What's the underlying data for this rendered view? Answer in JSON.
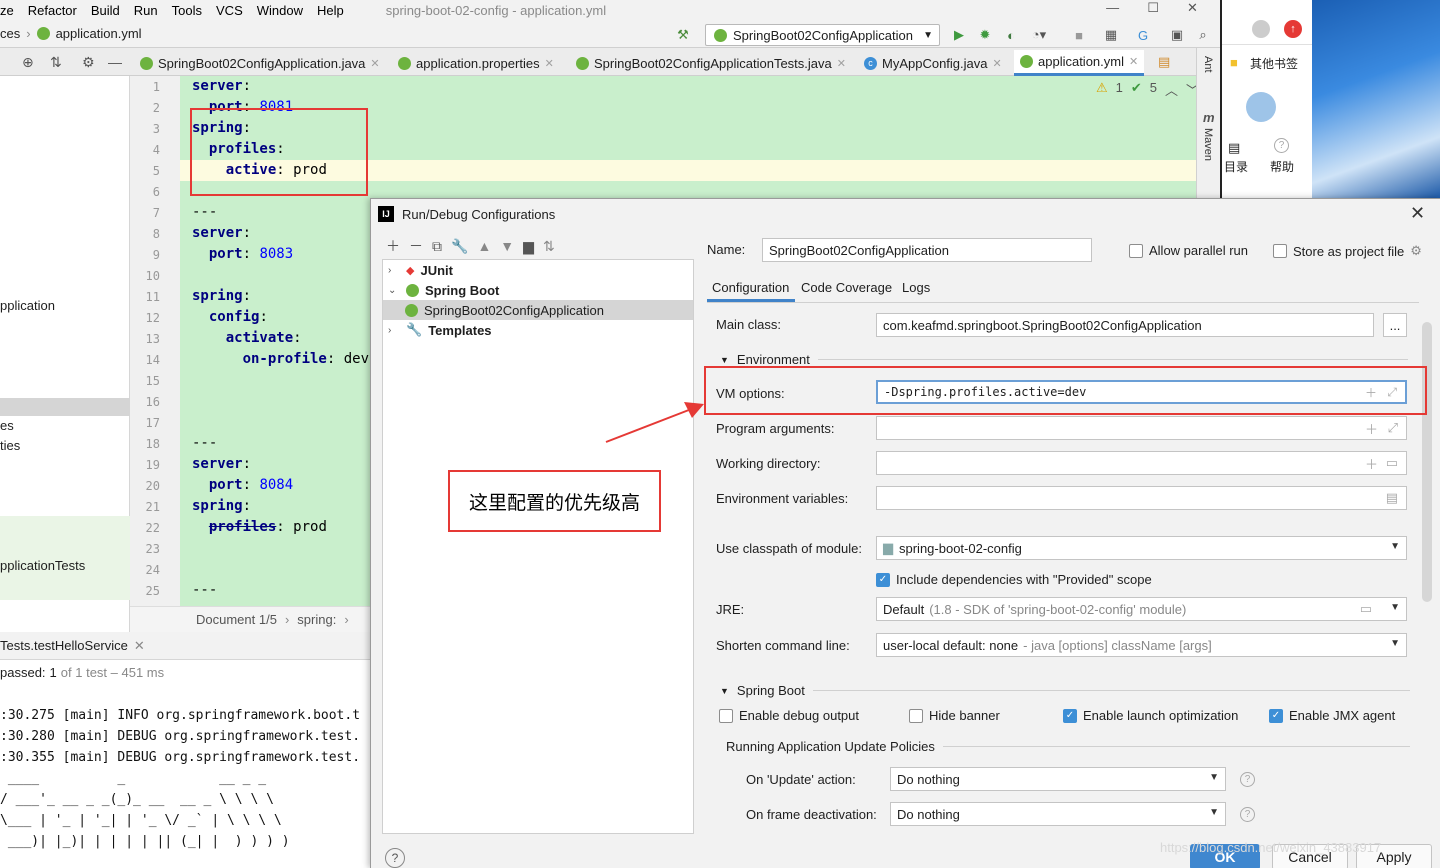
{
  "ide": {
    "menu": [
      "ze",
      "Refactor",
      "Build",
      "Run",
      "Tools",
      "VCS",
      "Window",
      "Help"
    ],
    "window_title": "spring-boot-02-config - application.yml",
    "breadcrumb_prev": "ces",
    "breadcrumb_file": "application.yml",
    "run_config": "SpringBoot02ConfigApplication",
    "tabs": [
      {
        "label": "SpringBoot02ConfigApplication.java",
        "icon": "spring-icon"
      },
      {
        "label": "application.properties",
        "icon": "spring-icon"
      },
      {
        "label": "SpringBoot02ConfigApplicationTests.java",
        "icon": "spring-icon"
      },
      {
        "label": "MyAppConfig.java",
        "icon": "class-icon"
      },
      {
        "label": "application.yml",
        "icon": "spring-icon"
      }
    ],
    "inspection_warnings": "1",
    "inspection_ok": "5",
    "right_strip": [
      "Ant",
      "Maven"
    ],
    "project_panel": [
      "pplication",
      "es",
      "ties",
      "pplicationTests"
    ],
    "status_doc": "Document 1/5",
    "status_path": "spring:",
    "status_more": "›"
  },
  "editor": {
    "line_numbers": [
      "1",
      "2",
      "3",
      "4",
      "5",
      "6",
      "7",
      "8",
      "9",
      "10",
      "11",
      "12",
      "13",
      "14",
      "15",
      "16",
      "17",
      "18",
      "19",
      "20",
      "21",
      "22",
      "23",
      "24",
      "25"
    ],
    "lines": {
      "l1_key": "server",
      "l2_key": "port",
      "l2_val": "8081",
      "l3_key": "spring",
      "l4_key": "profiles",
      "l5_key": "active",
      "l5_val": "prod",
      "l7": "---",
      "l8_key": "server",
      "l9_key": "port",
      "l9_val": "8083",
      "l11_key": "spring",
      "l12_key": "config",
      "l13_key": "activate",
      "l14_key": "on-profile",
      "l14_val": "dev",
      "l18": "---",
      "l19_key": "server",
      "l20_key": "port",
      "l20_val": "8084",
      "l21_key": "spring",
      "l22_key": "profiles",
      "l22_val": "prod",
      "l25": "---"
    }
  },
  "run_panel": {
    "tab": "Tests.testHelloService",
    "status_passed": "passed:",
    "status_count": "1",
    "status_rest": "of 1 test – 451 ms",
    "console": [
      ":30.275 [main] INFO org.springframework.boot.t",
      ":30.280 [main] DEBUG org.springframework.test.",
      ":30.355 [main] DEBUG org.springframework.test.",
      "",
      " ____          _            __ _ _",
      "/ ___'_ __ _ _(_)_ __  __ _ \\ \\ \\ \\",
      "\\___ | '_ | '_| | '_ \\/ _` | \\ \\ \\ \\",
      " ___)| |_)| | | | | || (_| |  ) ) ) )"
    ]
  },
  "browser": {
    "bookmarks": "其他书签",
    "toc": "目录",
    "help": "帮助"
  },
  "annotation": {
    "callout": "这里配置的优先级高"
  },
  "dialog": {
    "title": "Run/Debug Configurations",
    "tree": {
      "junit": "JUnit",
      "spring_boot": "Spring Boot",
      "selected_config": "SpringBoot02ConfigApplication",
      "templates": "Templates"
    },
    "name_label": "Name:",
    "name_value": "SpringBoot02ConfigApplication",
    "allow_parallel": "Allow parallel run",
    "store_project": "Store as project file",
    "tabs": [
      "Configuration",
      "Code Coverage",
      "Logs"
    ],
    "main_class_label": "Main class:",
    "main_class_value": "com.keafmd.springboot.SpringBoot02ConfigApplication",
    "browse_btn": "...",
    "environment_section": "Environment",
    "vm_options_label": "VM options:",
    "vm_options_value": "-Dspring.profiles.active=dev",
    "program_args_label": "Program arguments:",
    "working_dir_label": "Working directory:",
    "env_vars_label": "Environment variables:",
    "classpath_label": "Use classpath of module:",
    "classpath_value": "spring-boot-02-config",
    "include_provided": "Include dependencies with \"Provided\" scope",
    "jre_label": "JRE:",
    "jre_value": "Default",
    "jre_hint": "(1.8 - SDK of 'spring-boot-02-config' module)",
    "shorten_label": "Shorten command line:",
    "shorten_value": "user-local default: none",
    "shorten_hint": "- java [options] className [args]",
    "spring_boot_section": "Spring Boot",
    "enable_debug": "Enable debug output",
    "hide_banner": "Hide banner",
    "launch_opt": "Enable launch optimization",
    "jmx_agent": "Enable JMX agent",
    "update_policies": "Running Application Update Policies",
    "on_update_label": "On 'Update' action:",
    "on_update_value": "Do nothing",
    "on_frame_label": "On frame deactivation:",
    "on_frame_value": "Do nothing",
    "ok": "OK",
    "cancel": "Cancel",
    "apply": "Apply",
    "help_btn": "?"
  },
  "watermark": "https://blog.csdn.net/weixin_43883917",
  "colors": {
    "editor_bg": "#c9efcc",
    "annotation_red": "#e53935",
    "accent_blue": "#3d8fd6",
    "spring_green": "#6db33f"
  }
}
